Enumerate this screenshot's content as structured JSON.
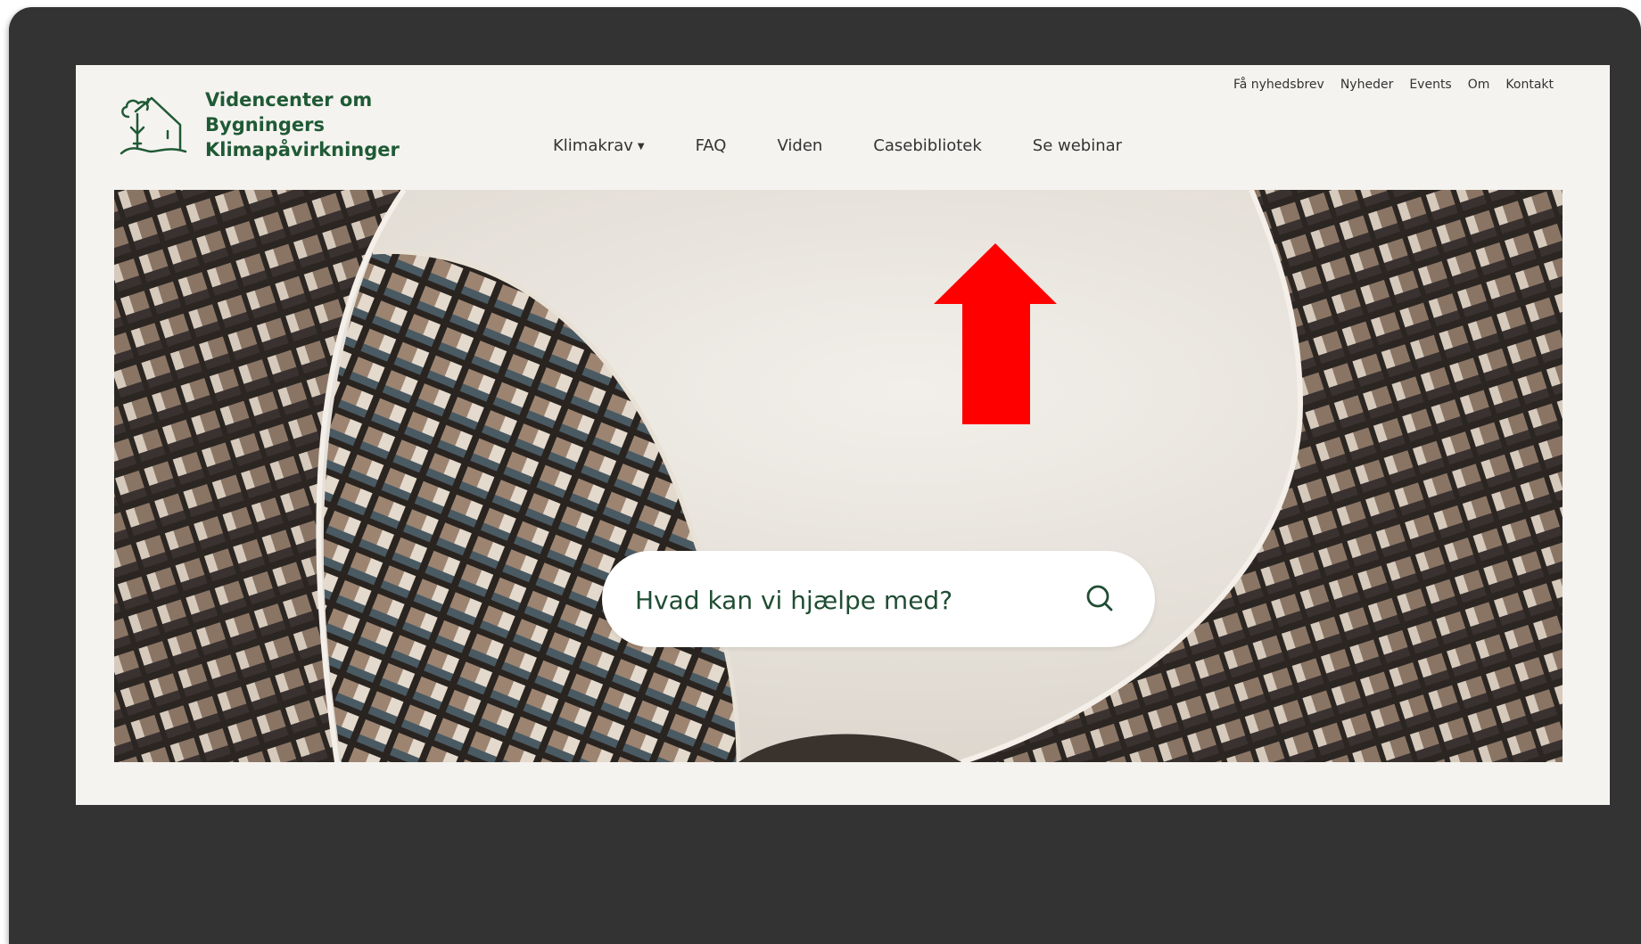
{
  "site": {
    "logo_lines": [
      "Videncenter om",
      "Bygningers",
      "Klimapåvirkninger"
    ],
    "logo_icon": "house-tree-icon"
  },
  "top_links": [
    {
      "label": "Få nyhedsbrev"
    },
    {
      "label": "Nyheder"
    },
    {
      "label": "Events"
    },
    {
      "label": "Om"
    },
    {
      "label": "Kontakt"
    }
  ],
  "main_nav": [
    {
      "label": "Klimakrav",
      "has_dropdown": true
    },
    {
      "label": "FAQ"
    },
    {
      "label": "Viden"
    },
    {
      "label": "Casebibliotek"
    },
    {
      "label": "Se webinar"
    }
  ],
  "search": {
    "placeholder": "Hvad kan vi hjælpe med?",
    "icon": "search-icon"
  },
  "annotation": {
    "type": "arrow-up",
    "color": "#ff0000",
    "target": "Casebibliotek"
  },
  "colors": {
    "brand_green": "#1f5a35",
    "page_bg": "#f5f3f0",
    "frame_bg": "#333333"
  }
}
